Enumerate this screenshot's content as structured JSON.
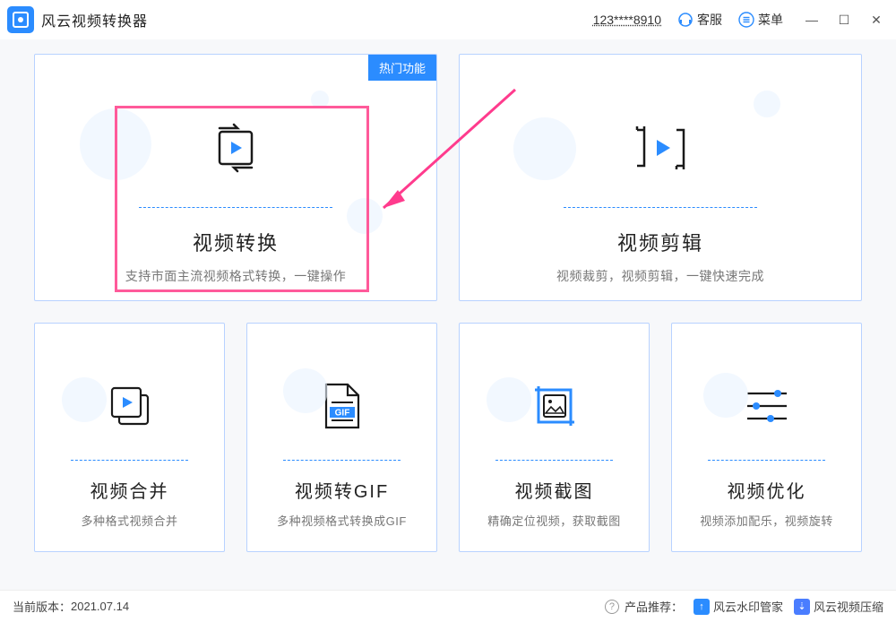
{
  "app_title": "风云视频转换器",
  "user_id": "123****8910",
  "support_label": "客服",
  "menu_label": "菜单",
  "badge_label": "热门功能",
  "cards": {
    "convert": {
      "title": "视频转换",
      "desc": "支持市面主流视频格式转换，一键操作"
    },
    "edit": {
      "title": "视频剪辑",
      "desc": "视频裁剪，视频剪辑，一键快速完成"
    },
    "merge": {
      "title": "视频合并",
      "desc": "多种格式视频合并"
    },
    "gif": {
      "title": "视频转GIF",
      "desc": "多种视频格式转换成GIF"
    },
    "screenshot": {
      "title": "视频截图",
      "desc": "精确定位视频，获取截图"
    },
    "optimize": {
      "title": "视频优化",
      "desc": "视频添加配乐，视频旋转"
    }
  },
  "footer": {
    "version_label": "当前版本：",
    "version": "2021.07.14",
    "recommend_label": "产品推荐：",
    "product1": "风云水印管家",
    "product2": "风云视频压缩"
  },
  "gif_badge": "GIF"
}
